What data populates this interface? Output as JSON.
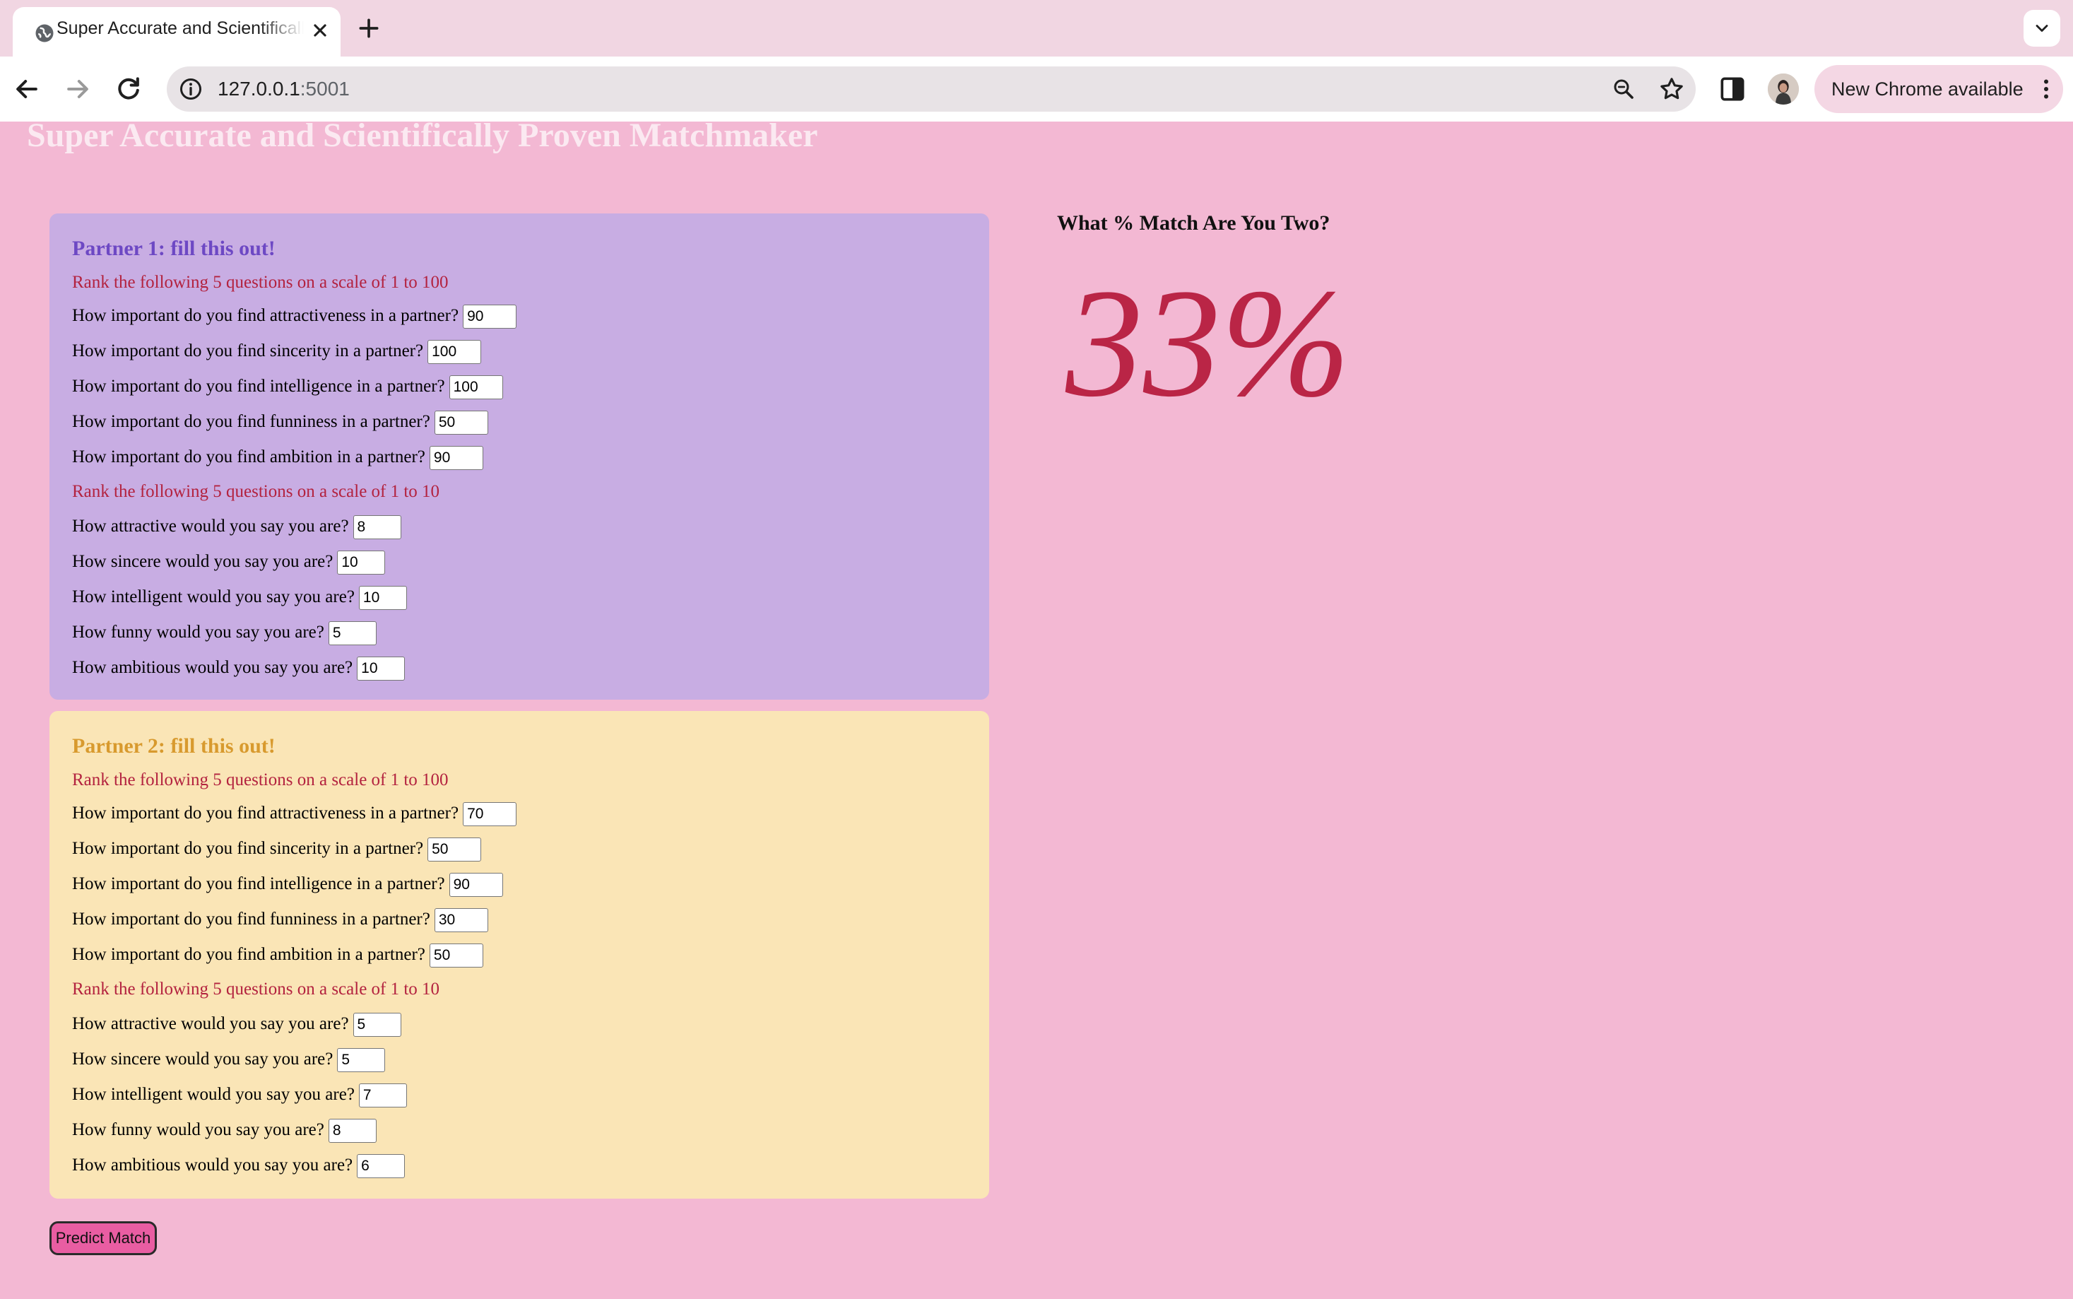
{
  "browser": {
    "tab_title": "Super Accurate and Scientifically Proven Matchmaker",
    "url_host": "127.0.0.1",
    "url_port": ":5001",
    "update_label": "New Chrome available"
  },
  "page": {
    "title": "Super Accurate and Scientifically Proven Matchmaker"
  },
  "partner1": {
    "heading": "Partner 1: fill this out!",
    "importance_instruction": "Rank the following 5 questions on a scale of 1 to 100",
    "importance": [
      {
        "label": "How important do you find attractiveness in a partner?",
        "value": "90"
      },
      {
        "label": "How important do you find sincerity in a partner?",
        "value": "100"
      },
      {
        "label": "How important do you find intelligence in a partner?",
        "value": "100"
      },
      {
        "label": "How important do you find funniness in a partner?",
        "value": "50"
      },
      {
        "label": "How important do you find ambition in a partner?",
        "value": "90"
      }
    ],
    "self_instruction": "Rank the following 5 questions on a scale of 1 to 10",
    "self": [
      {
        "label": "How attractive would you say you are?",
        "value": "8"
      },
      {
        "label": "How sincere would you say you are?",
        "value": "10"
      },
      {
        "label": "How intelligent would you say you are?",
        "value": "10"
      },
      {
        "label": "How funny would you say you are?",
        "value": "5"
      },
      {
        "label": "How ambitious would you say you are?",
        "value": "10"
      }
    ]
  },
  "partner2": {
    "heading": "Partner 2: fill this out!",
    "importance_instruction": "Rank the following 5 questions on a scale of 1 to 100",
    "importance": [
      {
        "label": "How important do you find attractiveness in a partner?",
        "value": "70"
      },
      {
        "label": "How important do you find sincerity in a partner?",
        "value": "50"
      },
      {
        "label": "How important do you find intelligence in a partner?",
        "value": "90"
      },
      {
        "label": "How important do you find funniness in a partner?",
        "value": "30"
      },
      {
        "label": "How important do you find ambition in a partner?",
        "value": "50"
      }
    ],
    "self_instruction": "Rank the following 5 questions on a scale of 1 to 10",
    "self": [
      {
        "label": "How attractive would you say you are?",
        "value": "5"
      },
      {
        "label": "How sincere would you say you are?",
        "value": "5"
      },
      {
        "label": "How intelligent would you say you are?",
        "value": "7"
      },
      {
        "label": "How funny would you say you are?",
        "value": "8"
      },
      {
        "label": "How ambitious would you say you are?",
        "value": "6"
      }
    ]
  },
  "predict_button_label": "Predict Match",
  "result": {
    "heading": "What % Match Are You Two?",
    "value": "33%"
  },
  "colors": {
    "page_background": "#f3b8d3",
    "partner1_panel": "#c8ade3",
    "partner1_heading": "#6d48c4",
    "partner2_panel": "#fae5b6",
    "partner2_heading": "#d89a2e",
    "instruction_text": "#b3223f",
    "result_value": "#ba2546",
    "predict_button": "#e95da2"
  },
  "icons": [
    "globe-icon",
    "close-icon",
    "plus-icon",
    "chevron-down-icon",
    "back-arrow-icon",
    "forward-arrow-icon",
    "reload-icon",
    "info-icon",
    "zoom-icon",
    "star-icon",
    "side-panel-icon",
    "profile-avatar",
    "more-vert-icon"
  ]
}
